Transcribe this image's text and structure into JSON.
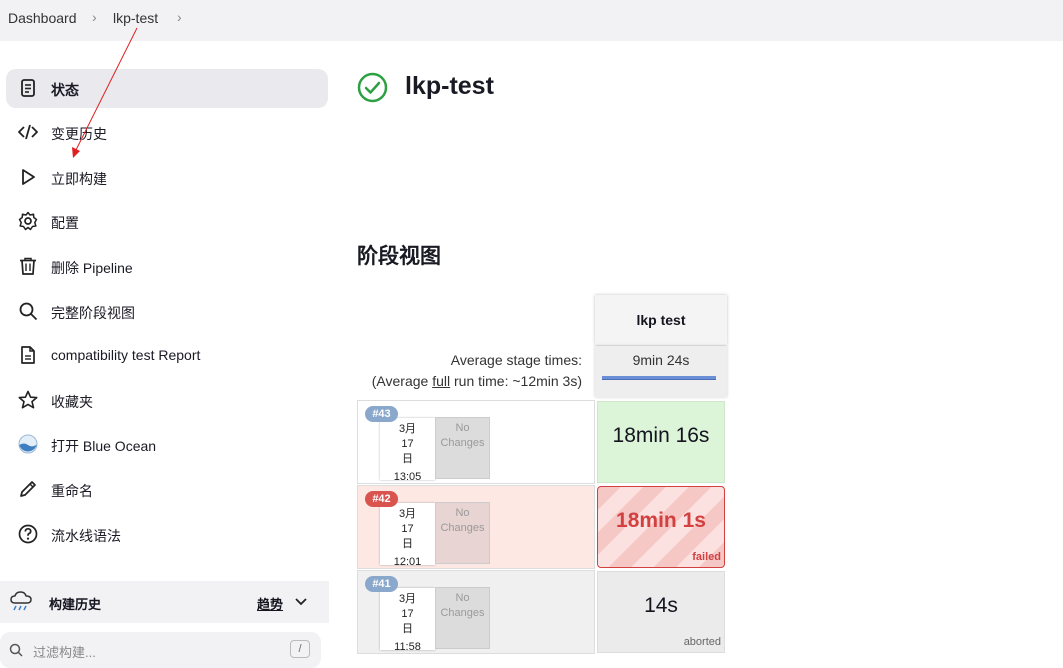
{
  "breadcrumb": {
    "items": [
      "Dashboard",
      "lkp-test"
    ]
  },
  "sidebar": {
    "items": [
      {
        "label": "状态",
        "icon": "document-icon",
        "active": true
      },
      {
        "label": "变更历史",
        "icon": "code-icon"
      },
      {
        "label": "立即构建",
        "icon": "play-icon"
      },
      {
        "label": "配置",
        "icon": "gear-icon"
      },
      {
        "label": "删除 Pipeline",
        "icon": "trash-icon"
      },
      {
        "label": "完整阶段视图",
        "icon": "search-icon"
      },
      {
        "label": "compatibility test Report",
        "icon": "file-icon"
      },
      {
        "label": "收藏夹",
        "icon": "star-icon"
      },
      {
        "label": "打开 Blue Ocean",
        "icon": "blue-ocean-icon"
      },
      {
        "label": "重命名",
        "icon": "pencil-icon"
      },
      {
        "label": "流水线语法",
        "icon": "help-icon"
      }
    ],
    "build_history": {
      "title": "构建历史",
      "trend": "趋势",
      "filter_placeholder": "过滤构建...",
      "filter_shortcut": "/"
    }
  },
  "main": {
    "title": "lkp-test",
    "status": "success",
    "stage_view_title": "阶段视图",
    "stage_view": {
      "stage_name": "lkp test",
      "avg_label_line1": "Average stage times:",
      "avg_label_prefix": "(Average ",
      "avg_label_link": "full",
      "avg_label_suffix": " run time: ~12min 3s)",
      "avg_stage_time": "9min 24s",
      "runs": [
        {
          "id": "#43",
          "date": "3月 17 日",
          "time": "13:05",
          "changes": "No Changes",
          "duration": "18min 16s",
          "status": "success",
          "status_label": ""
        },
        {
          "id": "#42",
          "date": "3月 17 日",
          "time": "12:01",
          "changes": "No Changes",
          "duration": "18min 1s",
          "status": "failed",
          "status_label": "failed"
        },
        {
          "id": "#41",
          "date": "3月 17 日",
          "time": "11:58",
          "changes": "No Changes",
          "duration": "14s",
          "status": "aborted",
          "status_label": "aborted"
        }
      ]
    }
  },
  "colors": {
    "success": "#2ca043",
    "failed": "#d24040",
    "accent_bar": "#6b8fd6",
    "annotation_arrow": "#e02020"
  }
}
